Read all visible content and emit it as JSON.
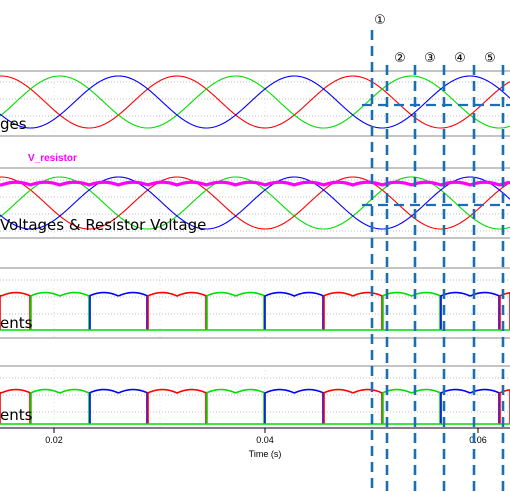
{
  "chart_data": {
    "type": "line",
    "xlabel": "Time (s)",
    "x_ticks": [
      "0.02",
      "0.04",
      "0.06"
    ],
    "colors": {
      "phase_a": "#ff0000",
      "phase_b": "#00dd00",
      "phase_c": "#0000ff",
      "resistor": "#ff00ff",
      "marker": "#1a6fb4"
    },
    "markers": [
      "①",
      "②",
      "③",
      "④",
      "⑤"
    ],
    "panels": [
      {
        "title": "ges",
        "series": [
          {
            "type": "sine",
            "phase": "a"
          },
          {
            "type": "sine",
            "phase": "b"
          },
          {
            "type": "sine",
            "phase": "c"
          }
        ]
      },
      {
        "title": "Voltages & Resistor Voltage",
        "series_label": "V_resistor",
        "series": [
          {
            "type": "sine",
            "phase": "a"
          },
          {
            "type": "sine",
            "phase": "b"
          },
          {
            "type": "sine",
            "phase": "c"
          },
          {
            "type": "rectified_max"
          }
        ]
      },
      {
        "title": "ents",
        "series": [
          {
            "type": "block_current"
          }
        ]
      },
      {
        "title": "ents",
        "series": [
          {
            "type": "block_current"
          }
        ]
      }
    ]
  }
}
